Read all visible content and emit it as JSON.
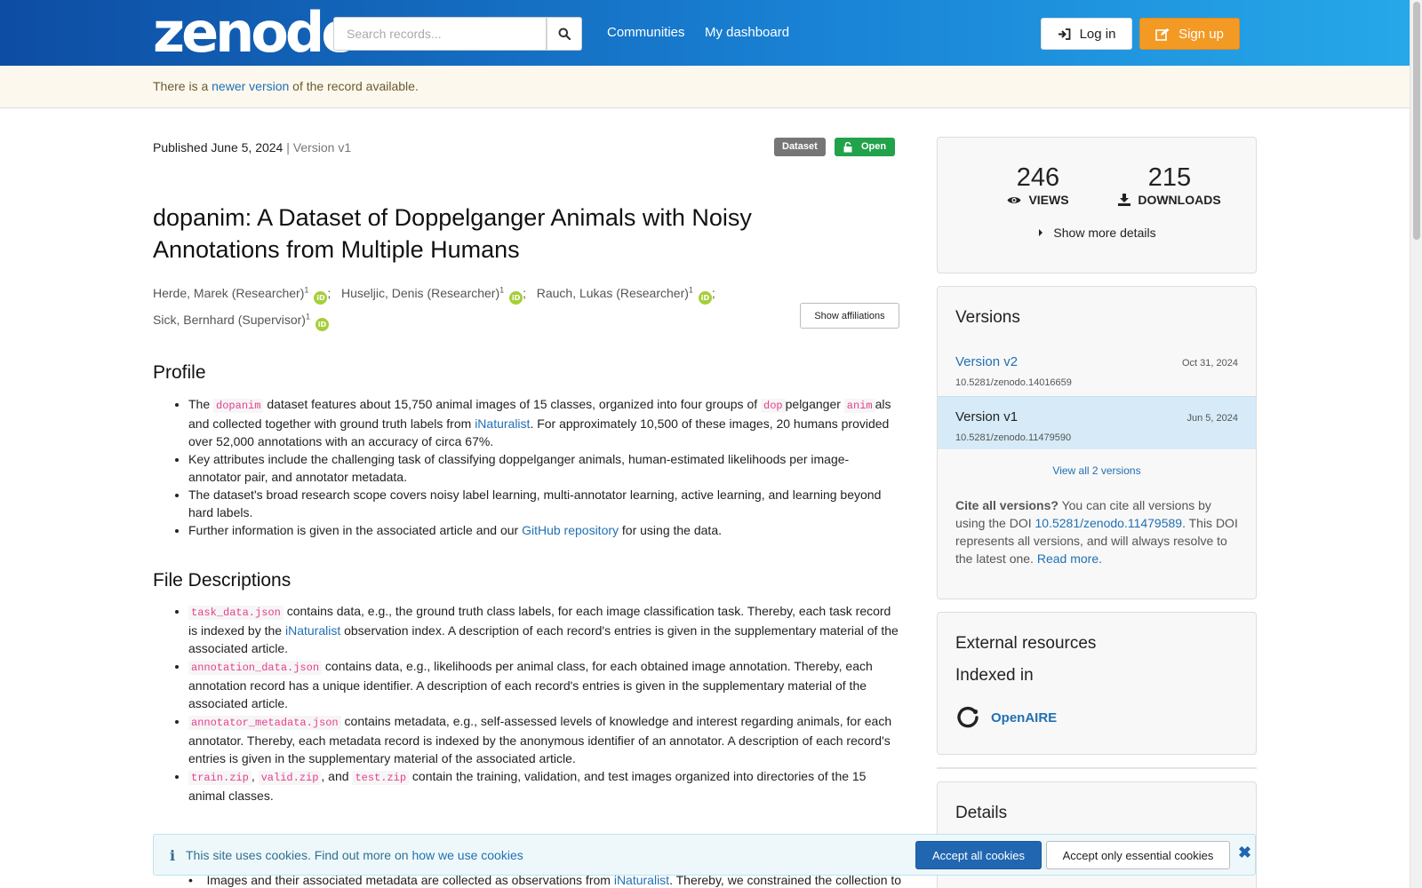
{
  "header": {
    "logo": "zenodo",
    "search_placeholder": "Search records...",
    "nav": [
      "Communities",
      "My dashboard"
    ],
    "login_label": "Log in",
    "signup_label": "Sign up"
  },
  "banner": {
    "prefix": "There is a ",
    "link": "newer version",
    "suffix": " of the record available."
  },
  "record": {
    "published": "Published June 5, 2024",
    "version_sep": " | Version v1",
    "badge_type": "Dataset",
    "badge_access": "Open",
    "title": "dopanim: A Dataset of Doppelganger Animals with Noisy Annotations from Multiple Humans",
    "authors": [
      {
        "name": "Herde, Marek (Researcher)",
        "aff": "1",
        "sep": ";"
      },
      {
        "name": "Huseljic, Denis (Researcher)",
        "aff": "1",
        "sep": ";"
      },
      {
        "name": "Rauch, Lukas (Researcher)",
        "aff": "1",
        "sep": ";"
      },
      {
        "name": "Sick, Bernhard (Supervisor)",
        "aff": "1",
        "sep": ""
      }
    ],
    "orcid_label": "iD",
    "show_affiliations": "Show affiliations"
  },
  "profile": {
    "heading": "Profile",
    "b1": {
      "t1": "The ",
      "c1": "dopanim",
      "t2": " dataset features about 15,750 animal images of 15 classes, organized into four groups of ",
      "c2": "dop",
      "t3": "pelganger ",
      "c3": "anim",
      "t4": "als and collected together with ground truth labels from ",
      "link": "iNaturalist",
      "t5": ". For approximately 10,500 of these images, 20 humans provided over 52,000 annotations with an accuracy of circa 67%."
    },
    "b2": "Key attributes include the challenging task of classifying doppelganger animals, human-estimated likelihoods per image-annotator pair, and annotator metadata.",
    "b3": "The dataset's broad research scope covers noisy label learning, multi-annotator learning, active learning, and learning beyond hard labels.",
    "b4": {
      "t1": "Further information is given in the associated article and our ",
      "link": "GitHub repository",
      "t2": " for using the data."
    }
  },
  "files": {
    "heading": "File Descriptions",
    "f1": {
      "code": "task_data.json",
      "t1": " contains data, e.g., the ground truth class labels, for each image classification task. Thereby, each task record is indexed by the ",
      "link": "iNaturalist",
      "t2": " observation index. A description of each record's entries is given in the supplementary material of the associated article."
    },
    "f2": {
      "code": "annotation_data.json",
      "t1": " contains data, e.g., likelihoods per animal class, for each obtained image annotation. Thereby, each annotation record has a unique identifier. A description of each record's entries is given in the supplementary material of the associated article."
    },
    "f3": {
      "code": "annotator_metadata.json",
      "t1": " contains metadata, e.g., self-assessed levels of knowledge and interest regarding animals, for each annotator. Thereby, each metadata record is indexed by the anonymous identifier of an annotator. A description of each record's entries is given in the supplementary material of the associated article."
    },
    "f4": {
      "c1": "train.zip",
      "s1": ", ",
      "c2": "valid.zip",
      "s2": ", and ",
      "c3": "test.zip",
      "t1": " contain the training, validation, and test images organized into directories of the 15 animal classes."
    }
  },
  "partial": {
    "t1": "Images and their associated metadata are collected as observations from ",
    "link": "iNaturalist",
    "t2": ". Thereby, we constrained the collection to"
  },
  "stats": {
    "views": "246",
    "views_label": "VIEWS",
    "downloads": "215",
    "downloads_label": "DOWNLOADS",
    "more": "Show more details"
  },
  "versions": {
    "heading": "Versions",
    "items": [
      {
        "name": "Version v2",
        "doi": "10.5281/zenodo.14016659",
        "date": "Oct 31, 2024"
      },
      {
        "name": "Version v1",
        "doi": "10.5281/zenodo.11479590",
        "date": "Jun 5, 2024"
      }
    ],
    "view_all": "View all 2 versions",
    "cite_bold": "Cite all versions?",
    "cite_t1": " You can cite all versions by using the DOI ",
    "cite_doi": "10.5281/zenodo.11479589",
    "cite_t2": ". This DOI represents all versions, and will always resolve to the latest one. ",
    "cite_more": "Read more."
  },
  "external": {
    "heading": "External resources",
    "sub": "Indexed in",
    "item": "OpenAIRE"
  },
  "details": {
    "heading": "Details"
  },
  "cookie": {
    "t1": "This site uses cookies. Find out more on ",
    "link": "how we use cookies",
    "accept_all": "Accept all cookies",
    "accept_essential": "Accept only essential cookies"
  },
  "colors": {
    "header_start": "#0d4da3",
    "header_end": "#26a8e9",
    "signup": "#f39a25",
    "open_badge": "#21a24b",
    "link": "#2170b3"
  },
  "icons": [
    "search-icon",
    "login-icon",
    "edit-icon",
    "unlock-icon",
    "eye-icon",
    "download-icon",
    "caret-right-icon",
    "openaire-icon",
    "info-icon",
    "close-icon"
  ]
}
